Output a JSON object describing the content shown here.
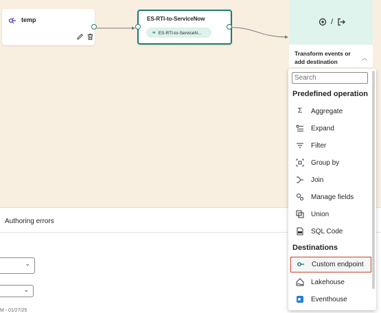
{
  "source_node": {
    "title": "temp",
    "icon": "source-icon"
  },
  "stream_node": {
    "title": "ES-RTI-to-ServiceNow",
    "pill": "ES-RTI-to-ServiceN..."
  },
  "destination_panel": {
    "label": "Transform events or add destination",
    "icons": {
      "separator": "/"
    }
  },
  "bottom_pane": {
    "tab": "Authoring errors",
    "footer_text": "M - 01/27/25"
  },
  "dropdown": {
    "search_placeholder": "Search",
    "predefined_header": "Predefined operation",
    "operations": [
      {
        "label": "Aggregate",
        "icon": "sigma-icon"
      },
      {
        "label": "Expand",
        "icon": "expand-icon"
      },
      {
        "label": "Filter",
        "icon": "filter-icon"
      },
      {
        "label": "Group by",
        "icon": "group-by-icon"
      },
      {
        "label": "Join",
        "icon": "join-icon"
      },
      {
        "label": "Manage fields",
        "icon": "manage-fields-icon"
      },
      {
        "label": "Union",
        "icon": "union-icon"
      },
      {
        "label": "SQL Code",
        "icon": "sql-icon"
      }
    ],
    "destinations_header": "Destinations",
    "destinations": [
      {
        "label": "Custom endpoint",
        "icon": "custom-endpoint-icon",
        "selected": true
      },
      {
        "label": "Lakehouse",
        "icon": "lakehouse-icon"
      },
      {
        "label": "Eventhouse",
        "icon": "eventhouse-icon"
      }
    ]
  },
  "colors": {
    "canvas": "#f9efe1",
    "accent": "#1b7d6a",
    "selected_border": "#c0462a"
  }
}
